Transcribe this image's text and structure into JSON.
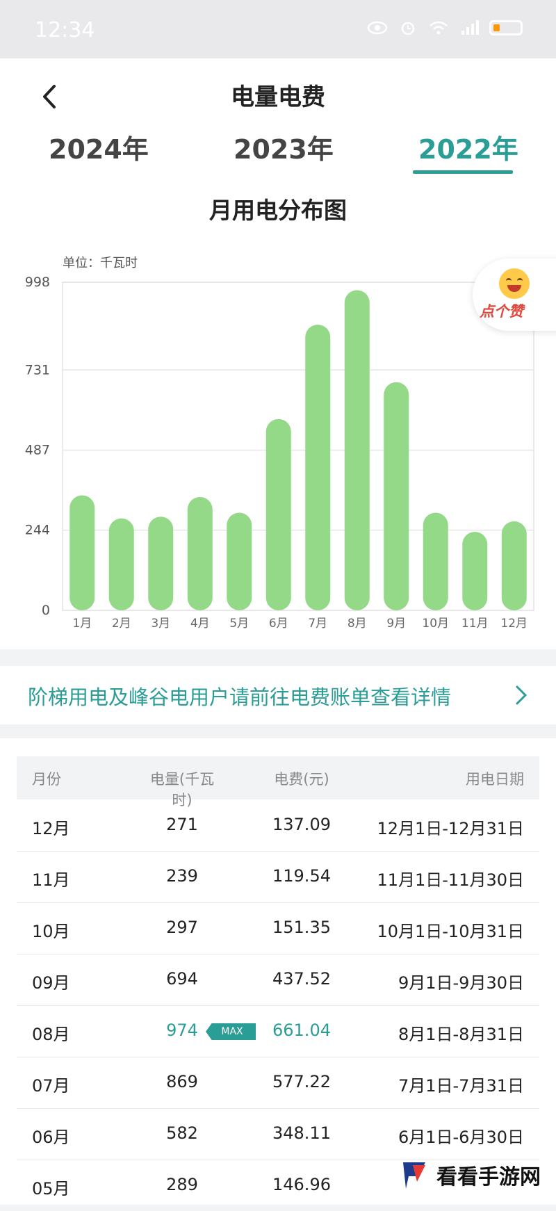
{
  "status_bar": {
    "time": "12:34"
  },
  "header": {
    "title": "电量电费"
  },
  "year_tabs": [
    {
      "label": "2024年",
      "active": false
    },
    {
      "label": "2023年",
      "active": false
    },
    {
      "label": "2022年",
      "active": true
    }
  ],
  "chart_data": {
    "type": "bar",
    "title": "月用电分布图",
    "ylabel": "单位：千瓦时",
    "categories": [
      "1月",
      "2月",
      "3月",
      "4月",
      "5月",
      "6月",
      "7月",
      "8月",
      "9月",
      "10月",
      "11月",
      "12月"
    ],
    "values": [
      350,
      280,
      285,
      345,
      297,
      582,
      869,
      974,
      694,
      297,
      239,
      271
    ],
    "yticks": [
      0,
      244,
      487,
      731,
      998
    ],
    "ylim": [
      0,
      998
    ],
    "bar_color": "#94d987",
    "grid": true
  },
  "like_widget": {
    "label": "点个赞"
  },
  "notice": {
    "text": "阶梯用电及峰谷电用户请前往电费账单查看详情"
  },
  "table": {
    "headers": {
      "month": "月份",
      "kwh": "电量(千瓦时)",
      "fee": "电费(元)",
      "period": "用电日期"
    },
    "max_badge": "MAX",
    "rows": [
      {
        "month": "12月",
        "kwh": "271",
        "fee": "137.09",
        "period": "12月1日-12月31日",
        "max": false
      },
      {
        "month": "11月",
        "kwh": "239",
        "fee": "119.54",
        "period": "11月1日-11月30日",
        "max": false
      },
      {
        "month": "10月",
        "kwh": "297",
        "fee": "151.35",
        "period": "10月1日-10月31日",
        "max": false
      },
      {
        "month": "09月",
        "kwh": "694",
        "fee": "437.52",
        "period": "9月1日-9月30日",
        "max": false
      },
      {
        "month": "08月",
        "kwh": "974",
        "fee": "661.04",
        "period": "8月1日-8月31日",
        "max": true
      },
      {
        "month": "07月",
        "kwh": "869",
        "fee": "577.22",
        "period": "7月1日-7月31日",
        "max": false
      },
      {
        "month": "06月",
        "kwh": "582",
        "fee": "348.11",
        "period": "6月1日-6月30日",
        "max": false
      },
      {
        "month": "05月",
        "kwh": "289",
        "fee": "146.96",
        "period": "",
        "max": false
      }
    ]
  },
  "watermark": {
    "text": "看看手游网"
  },
  "colors": {
    "accent": "#2a9d96",
    "bar": "#94d987",
    "like_text": "#e0473a"
  }
}
